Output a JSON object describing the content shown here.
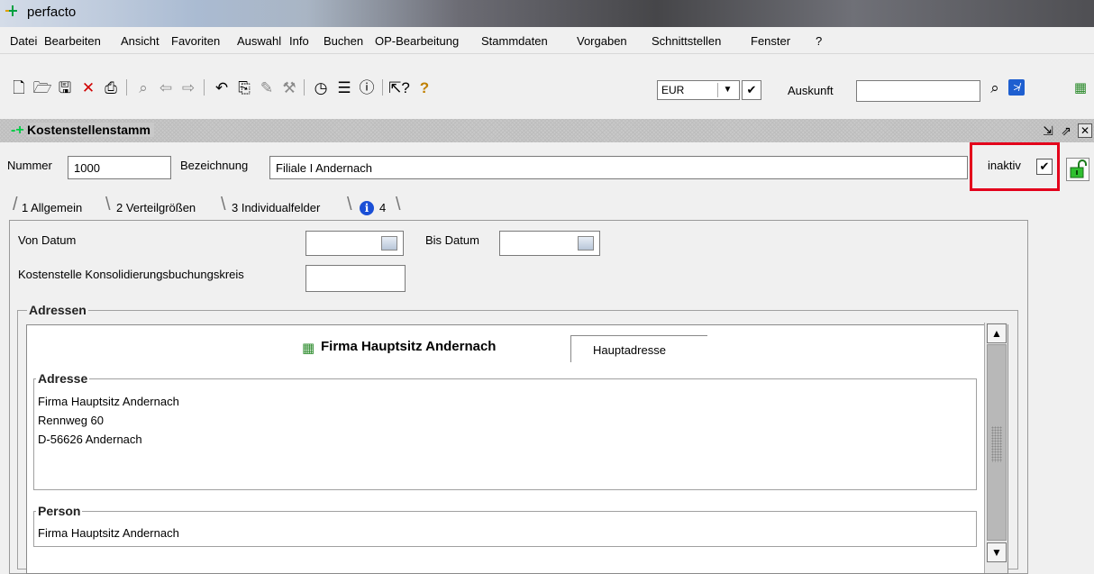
{
  "app": {
    "title": "perfacto"
  },
  "menu": [
    "Datei",
    "Bearbeiten",
    "Ansicht",
    "Favoriten",
    "Auswahl",
    "Info",
    "Buchen",
    "OP-Bearbeitung",
    "Stammdaten",
    "Vorgaben",
    "Schnittstellen",
    "Fenster",
    "?"
  ],
  "toolbar": {
    "currency": "EUR",
    "auskunft_label": "Auskunft",
    "auskunft_value": ""
  },
  "window": {
    "title": "Kostenstellenstamm"
  },
  "form": {
    "nummer_label": "Nummer",
    "nummer_value": "1000",
    "bezeichnung_label": "Bezeichnung",
    "bezeichnung_value": "Filiale I  Andernach",
    "inaktiv_label": "inaktiv",
    "inaktiv_checked": true
  },
  "tabs": [
    {
      "label": "1 Allgemein",
      "active": true
    },
    {
      "label": "2 Verteilgrößen",
      "active": false
    },
    {
      "label": "3 Individualfelder",
      "active": false
    },
    {
      "label": "4",
      "active": false
    }
  ],
  "general": {
    "von_datum_label": "Von Datum",
    "von_datum_value": "",
    "bis_datum_label": "Bis Datum",
    "bis_datum_value": "",
    "konsolidierung_label": "Kostenstelle Konsolidierungsbuchungskreis",
    "konsolidierung_value": ""
  },
  "adressen": {
    "group_title": "Adressen",
    "firm_name": "Firma  Hauptsitz Andernach",
    "address_type": "Hauptadresse",
    "adresse_title": "Adresse",
    "address_lines": [
      "Firma Hauptsitz Andernach",
      "Rennweg 60",
      "D-56626 Andernach"
    ],
    "person_title": "Person",
    "person_value": "Firma Hauptsitz Andernach"
  },
  "colors": {
    "highlight": "#e3001b",
    "app_icon_green": "#00c040",
    "info_blue": "#1a4fd6"
  }
}
